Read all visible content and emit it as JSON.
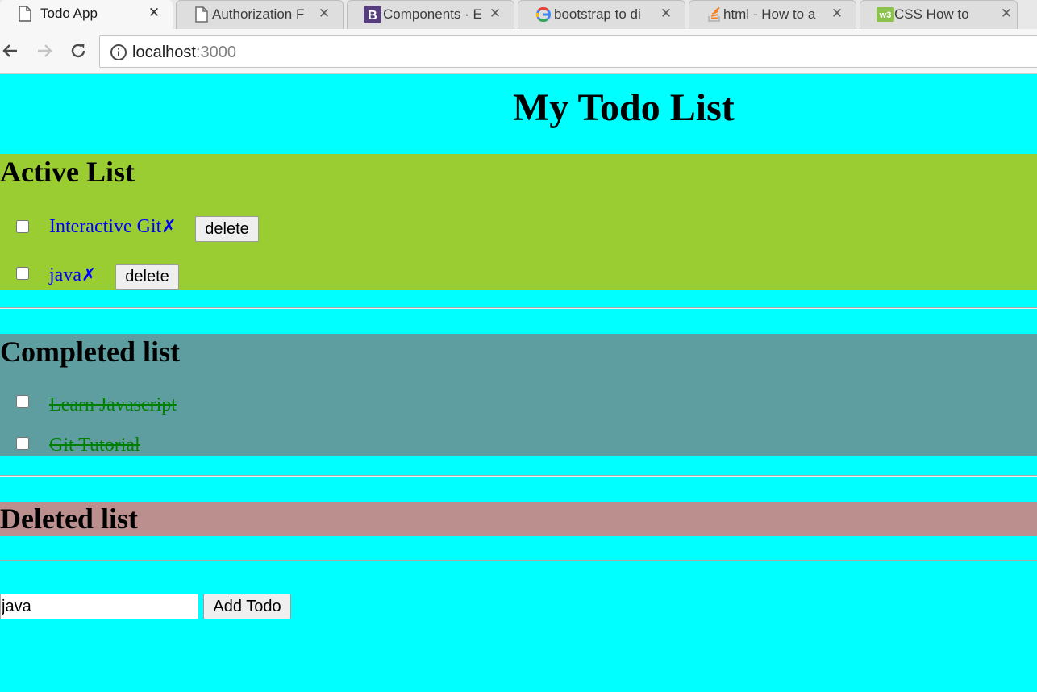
{
  "browser": {
    "tabs": [
      {
        "title": "Todo App",
        "icon": "page-icon"
      },
      {
        "title": "Authorization F",
        "icon": "page-icon"
      },
      {
        "title": "Components · E",
        "icon": "bootstrap-icon"
      },
      {
        "title": "bootstrap to di",
        "icon": "google-icon"
      },
      {
        "title": "html - How to a",
        "icon": "stackoverflow-icon"
      },
      {
        "title": "CSS How to",
        "icon": "w3schools-icon"
      }
    ],
    "tab_close_glyph": "✕",
    "address": {
      "host": "localhost",
      "port": ":3000"
    }
  },
  "page": {
    "title": "My Todo List",
    "active_list": {
      "heading": "Active List",
      "items": [
        {
          "text": "Interactive Git",
          "mark": "✗",
          "delete_label": "delete"
        },
        {
          "text": "java",
          "mark": "✗",
          "delete_label": "delete"
        }
      ]
    },
    "completed_list": {
      "heading": "Completed list",
      "items": [
        {
          "text": "Learn Javascript"
        },
        {
          "text": "Git Tutorial"
        }
      ]
    },
    "deleted_list": {
      "heading": "Deleted list",
      "items": []
    },
    "add_form": {
      "input_value": "java",
      "button_label": "Add Todo"
    }
  },
  "colors": {
    "page_background": "#00ffff",
    "active_list_background": "#9acd32",
    "completed_list_background": "#5f9ea0",
    "deleted_list_background": "#bc8f8f",
    "active_text": "#0000ff",
    "completed_text": "#008000"
  }
}
